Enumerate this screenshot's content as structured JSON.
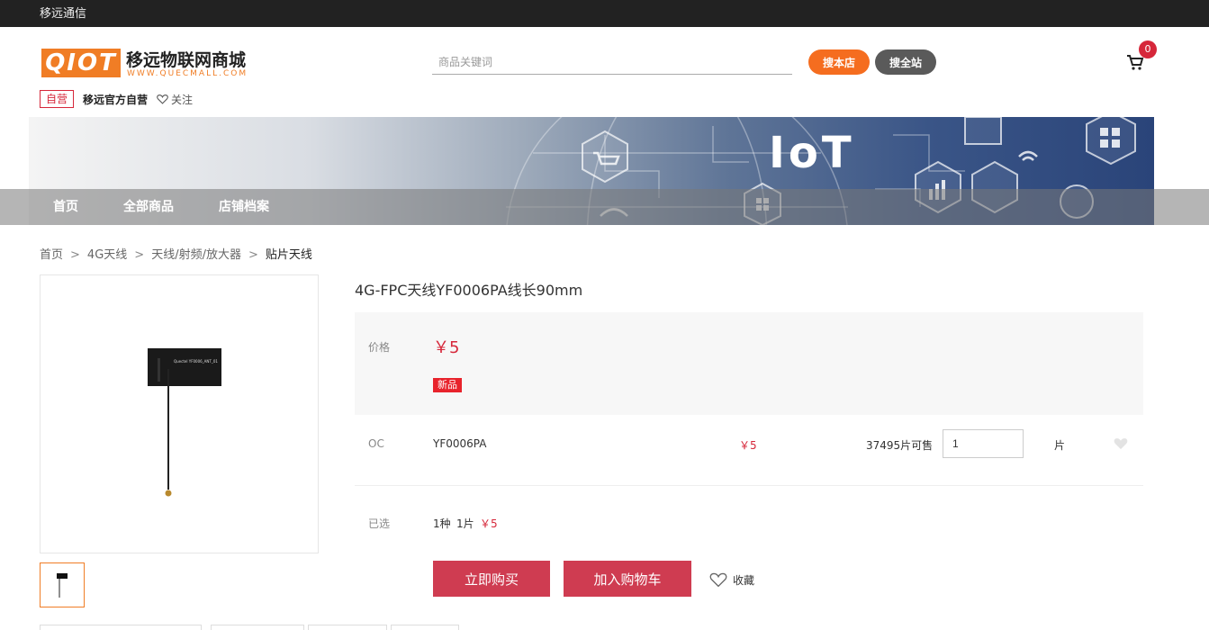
{
  "topbar": {
    "brand": "移远通信"
  },
  "logo": {
    "mark": "QIOT",
    "title": "移远物联网商城",
    "subtitle": "WWW.QUECMALL.COM"
  },
  "search": {
    "placeholder": "商品关键词",
    "btn_store": "搜本店",
    "btn_site": "搜全站"
  },
  "cart": {
    "count": "0"
  },
  "shop": {
    "tag": "自营",
    "name": "移远官方自营",
    "follow": "关注"
  },
  "banner": {
    "headline": "IoT"
  },
  "nav": {
    "items": [
      "首页",
      "全部商品",
      "店铺档案"
    ]
  },
  "breadcrumb": [
    "首页",
    "4G天线",
    "天线/射频/放大器",
    "贴片天线"
  ],
  "product": {
    "title": "4G-FPC天线YF0006PA线长90mm",
    "price_label": "价格",
    "price": "￥5",
    "new_tag": "新品",
    "image_caption": "Quectel YF0006_ANT_01"
  },
  "sku": {
    "type": "OC",
    "model": "YF0006PA",
    "price": "￥5",
    "stock": "37495片可售",
    "quantity": "1",
    "unit": "片"
  },
  "selected": {
    "label": "已选",
    "kinds": "1种",
    "pieces": "1片",
    "price": "￥5"
  },
  "actions": {
    "buy_now": "立即购买",
    "add_cart": "加入购物车",
    "collect": "收藏"
  },
  "colors": {
    "accent": "#f56d1f",
    "price": "#d6273a",
    "button": "#cf3c51"
  }
}
